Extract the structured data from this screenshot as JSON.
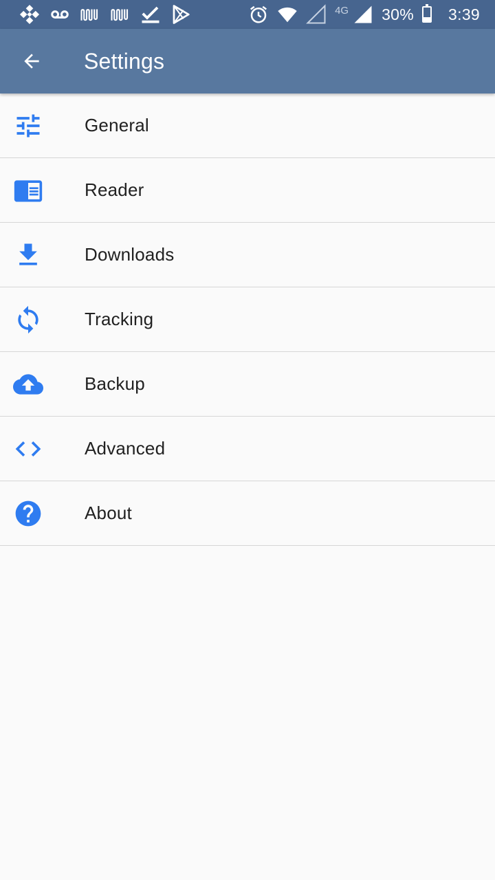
{
  "status_bar": {
    "network_type": "4G",
    "battery_percent": "30%",
    "battery_level": 0.3,
    "time": "3:39",
    "left_icons": [
      "binance-icon",
      "voicemail-icon",
      "app-notification-icon",
      "app-notification-icon",
      "check-icon",
      "play-store-icon"
    ],
    "right_icons": [
      "alarm-icon",
      "wifi-icon",
      "signal-empty-icon",
      "signal-full-icon",
      "battery-icon"
    ]
  },
  "app_bar": {
    "title": "Settings",
    "back_icon": "arrow-back-icon",
    "background": "#58789f"
  },
  "accent_color": "#2f7cf0",
  "settings": {
    "items": [
      {
        "label": "General",
        "icon": "tune-icon"
      },
      {
        "label": "Reader",
        "icon": "chrome-reader-icon"
      },
      {
        "label": "Downloads",
        "icon": "download-icon"
      },
      {
        "label": "Tracking",
        "icon": "sync-icon"
      },
      {
        "label": "Backup",
        "icon": "cloud-upload-icon"
      },
      {
        "label": "Advanced",
        "icon": "code-icon"
      },
      {
        "label": "About",
        "icon": "help-icon"
      }
    ]
  }
}
